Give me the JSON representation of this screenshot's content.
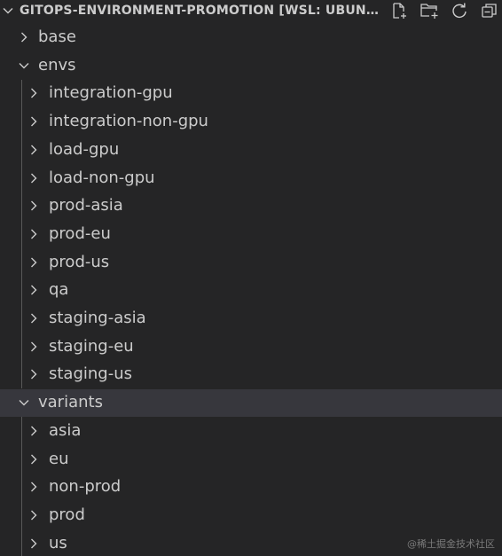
{
  "explorer": {
    "title": "GITOPS-ENVIRONMENT-PROMOTION [WSL: UBUNTU]",
    "toolbar": [
      {
        "name": "new-file-icon",
        "tooltip": "New File..."
      },
      {
        "name": "new-folder-icon",
        "tooltip": "New Folder..."
      },
      {
        "name": "refresh-icon",
        "tooltip": "Refresh Explorer"
      },
      {
        "name": "collapse-all-icon",
        "tooltip": "Collapse Folders in Explorer"
      }
    ]
  },
  "tree": [
    {
      "label": "base",
      "depth": 0,
      "expanded": false
    },
    {
      "label": "envs",
      "depth": 0,
      "expanded": true
    },
    {
      "label": "integration-gpu",
      "depth": 1,
      "expanded": false
    },
    {
      "label": "integration-non-gpu",
      "depth": 1,
      "expanded": false
    },
    {
      "label": "load-gpu",
      "depth": 1,
      "expanded": false
    },
    {
      "label": "load-non-gpu",
      "depth": 1,
      "expanded": false
    },
    {
      "label": "prod-asia",
      "depth": 1,
      "expanded": false
    },
    {
      "label": "prod-eu",
      "depth": 1,
      "expanded": false
    },
    {
      "label": "prod-us",
      "depth": 1,
      "expanded": false
    },
    {
      "label": "qa",
      "depth": 1,
      "expanded": false
    },
    {
      "label": "staging-asia",
      "depth": 1,
      "expanded": false
    },
    {
      "label": "staging-eu",
      "depth": 1,
      "expanded": false
    },
    {
      "label": "staging-us",
      "depth": 1,
      "expanded": false
    },
    {
      "label": "variants",
      "depth": 0,
      "expanded": true,
      "hovered": true
    },
    {
      "label": "asia",
      "depth": 1,
      "expanded": false
    },
    {
      "label": "eu",
      "depth": 1,
      "expanded": false
    },
    {
      "label": "non-prod",
      "depth": 1,
      "expanded": false
    },
    {
      "label": "prod",
      "depth": 1,
      "expanded": false
    },
    {
      "label": "us",
      "depth": 1,
      "expanded": false
    }
  ],
  "watermark": "@稀土掘金技术社区",
  "colors": {
    "background": "#252526",
    "hover_row": "#37373d",
    "text": "#cccccc",
    "indent_guide": "#585858"
  }
}
